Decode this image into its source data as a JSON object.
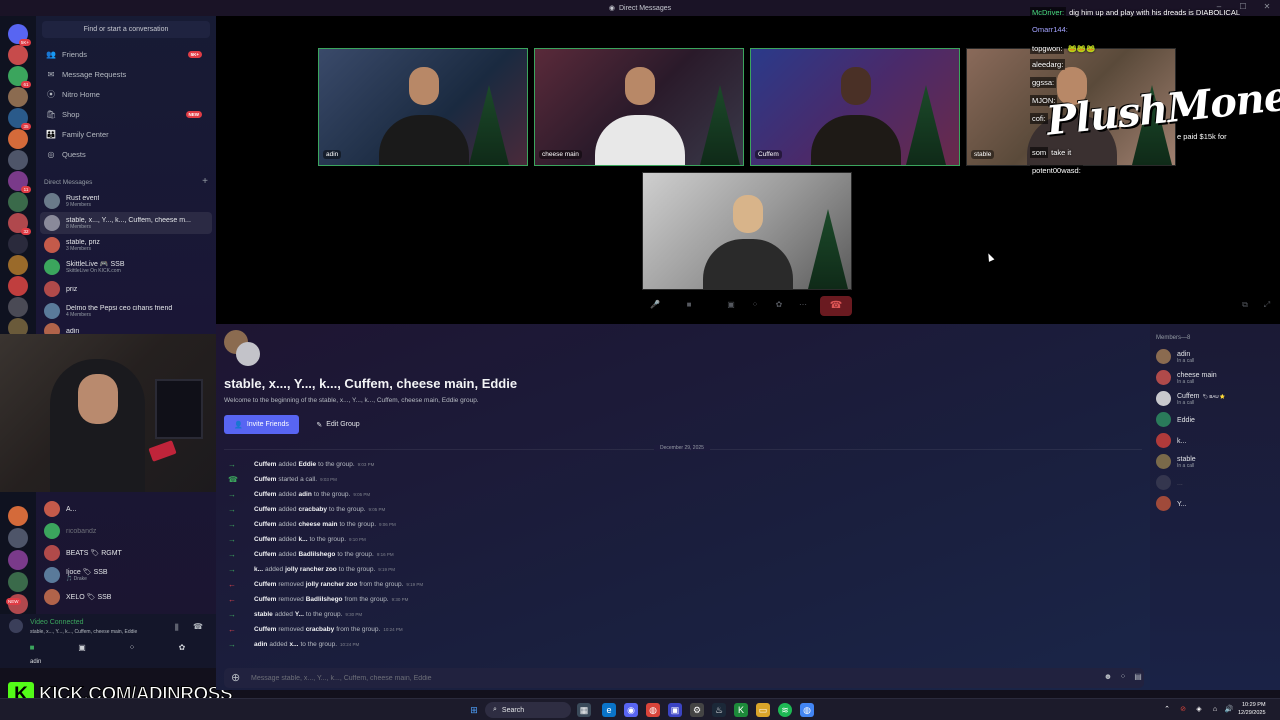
{
  "window": {
    "title": "Direct Messages"
  },
  "sidebar": {
    "search": "Find or start a conversation",
    "nav": [
      {
        "label": "Friends",
        "icon": "friends-icon",
        "glyph": "👥",
        "badge": "5K+"
      },
      {
        "label": "Message Requests",
        "icon": "message-requests-icon",
        "glyph": "✉",
        "badge": ""
      },
      {
        "label": "Nitro Home",
        "icon": "nitro-icon",
        "glyph": "⦿",
        "badge": ""
      },
      {
        "label": "Shop",
        "icon": "shop-icon",
        "glyph": "🛍",
        "badge": "NEW"
      },
      {
        "label": "Family Center",
        "icon": "family-center-icon",
        "glyph": "👪",
        "badge": ""
      },
      {
        "label": "Quests",
        "icon": "quests-icon",
        "glyph": "◎",
        "badge": ""
      }
    ],
    "dm_header": "Direct Messages",
    "dms": [
      {
        "name": "Rust event",
        "sub": "9 Members"
      },
      {
        "name": "stable, x..., Y..., k..., Cuffem, cheese m...",
        "sub": "8 Members"
      },
      {
        "name": "stable, priz",
        "sub": "3 Members"
      },
      {
        "name": "SkittleLive 🎮 SSB",
        "sub": "SkittleLive On KICK.com"
      },
      {
        "name": "priz",
        "sub": ""
      },
      {
        "name": "Delmo the Pepsi ceo cihans friend",
        "sub": "4 Members"
      },
      {
        "name": "adin",
        "sub": ""
      }
    ],
    "dms_lower": [
      {
        "name": "A...",
        "sub": ""
      },
      {
        "name": "ricobandz",
        "sub": ""
      },
      {
        "name": "BEATS 🏷 RGMT",
        "sub": ""
      },
      {
        "name": "Ijoce 🏷 SSB",
        "sub": "🎵 Drake"
      },
      {
        "name": "XELO 🏷 SSB",
        "sub": ""
      }
    ]
  },
  "server_badges": [
    "5K+",
    "",
    "61",
    "",
    "35",
    "",
    "",
    "11",
    "",
    "32",
    "",
    "",
    "",
    "",
    "",
    "",
    "68",
    "",
    "",
    "",
    "NEW"
  ],
  "voice": {
    "status": "Video Connected",
    "channel": "stable, x..., Y..., k..., Cuffem, cheese main, Eddie"
  },
  "user_panel": {
    "name": "adin"
  },
  "watermark": {
    "text": "KICK.COM/ADINROSS",
    "logo": "K"
  },
  "video_tiles": [
    {
      "label": "adin",
      "speaking": true
    },
    {
      "label": "cheese main",
      "speaking": true
    },
    {
      "label": "Cuffem",
      "speaking": true
    },
    {
      "label": "stable",
      "speaking": false
    },
    {
      "label": "",
      "speaking": false
    }
  ],
  "stream_chat": [
    {
      "user": "McDriver:",
      "msg": "dig him up and play with his dreads is DIABOLICAL",
      "color": "#4ade80"
    },
    {
      "user": "Omarr144:",
      "msg": "",
      "color": "#a3a3ff"
    },
    {
      "user": "topgwon:",
      "msg": "🐸🐸🐸",
      "color": "#ffffff"
    },
    {
      "user": "aleedarg:",
      "msg": "",
      "color": "#ffffff"
    },
    {
      "user": "ggssa:",
      "msg": "",
      "color": "#ffffff"
    },
    {
      "user": "MJON:",
      "msg": "",
      "color": "#ffffff"
    },
    {
      "user": "cofi:",
      "msg": "",
      "color": "#ffffff"
    },
    {
      "user": "",
      "msg": "e paid $15k for",
      "color": "#ffffff"
    },
    {
      "user": "som",
      "msg": "take it",
      "color": "#ffffff"
    },
    {
      "user": "potent00wasd:",
      "msg": "",
      "color": "#ffffff"
    }
  ],
  "brand_overlay": "PlushMoney",
  "chat": {
    "title": "stable, x..., Y..., k..., Cuffem, cheese main, Eddie",
    "welcome": "Welcome to the beginning of the stable, x..., Y..., k..., Cuffem, cheese main, Eddie group.",
    "invite_label": "Invite Friends",
    "edit_label": "Edit Group",
    "date": "December 29, 2025",
    "events": [
      {
        "dir": "in",
        "actor": "Cuffem",
        "verb": "added",
        "target": "Eddie",
        "rest": "to the group.",
        "time": "9:03 PM"
      },
      {
        "dir": "call",
        "actor": "Cuffem",
        "verb": "started a call.",
        "target": "",
        "rest": "",
        "time": "9:03 PM"
      },
      {
        "dir": "in",
        "actor": "Cuffem",
        "verb": "added",
        "target": "adin",
        "rest": "to the group.",
        "time": "9:05 PM"
      },
      {
        "dir": "in",
        "actor": "Cuffem",
        "verb": "added",
        "target": "cracbaby",
        "rest": "to the group.",
        "time": "9:05 PM"
      },
      {
        "dir": "in",
        "actor": "Cuffem",
        "verb": "added",
        "target": "cheese main",
        "rest": "to the group.",
        "time": "9:06 PM"
      },
      {
        "dir": "in",
        "actor": "Cuffem",
        "verb": "added",
        "target": "k...",
        "rest": "to the group.",
        "time": "9:10 PM"
      },
      {
        "dir": "in",
        "actor": "Cuffem",
        "verb": "added",
        "target": "Badlilshego",
        "rest": "to the group.",
        "time": "9:16 PM"
      },
      {
        "dir": "in",
        "actor": "k...",
        "verb": "added",
        "target": "jolly rancher zoo",
        "rest": "to the group.",
        "time": "9:19 PM"
      },
      {
        "dir": "out",
        "actor": "Cuffem",
        "verb": "removed",
        "target": "jolly rancher zoo",
        "rest": "from the group.",
        "time": "9:19 PM"
      },
      {
        "dir": "out",
        "actor": "Cuffem",
        "verb": "removed",
        "target": "Badlilshego",
        "rest": "from the group.",
        "time": "9:30 PM"
      },
      {
        "dir": "in",
        "actor": "stable",
        "verb": "added",
        "target": "Y...",
        "rest": "to the group.",
        "time": "9:30 PM"
      },
      {
        "dir": "out",
        "actor": "Cuffem",
        "verb": "removed",
        "target": "cracbaby",
        "rest": "from the group.",
        "time": "10:24 PM"
      },
      {
        "dir": "in",
        "actor": "adin",
        "verb": "added",
        "target": "x...",
        "rest": "to the group.",
        "time": "10:24 PM"
      }
    ],
    "input_placeholder": "Message stable, x..., Y..., k..., Cuffem, cheese main, Eddie"
  },
  "members": {
    "title": "Members—8",
    "list": [
      {
        "name": "adin",
        "status": "In a call",
        "tag": ""
      },
      {
        "name": "cheese main",
        "status": "In a call",
        "tag": ""
      },
      {
        "name": "Cuffem",
        "status": "In a call",
        "tag": "🏷 BAU ⭐"
      },
      {
        "name": "Eddie",
        "status": "",
        "tag": ""
      },
      {
        "name": "k...",
        "status": "",
        "tag": ""
      },
      {
        "name": "stable",
        "status": "In a call",
        "tag": ""
      },
      {
        "name": "...",
        "status": "",
        "tag": ""
      },
      {
        "name": "Y...",
        "status": "",
        "tag": ""
      }
    ]
  },
  "taskbar": {
    "search": "Search",
    "time": "10:29 PM",
    "date": "12/29/2025"
  }
}
